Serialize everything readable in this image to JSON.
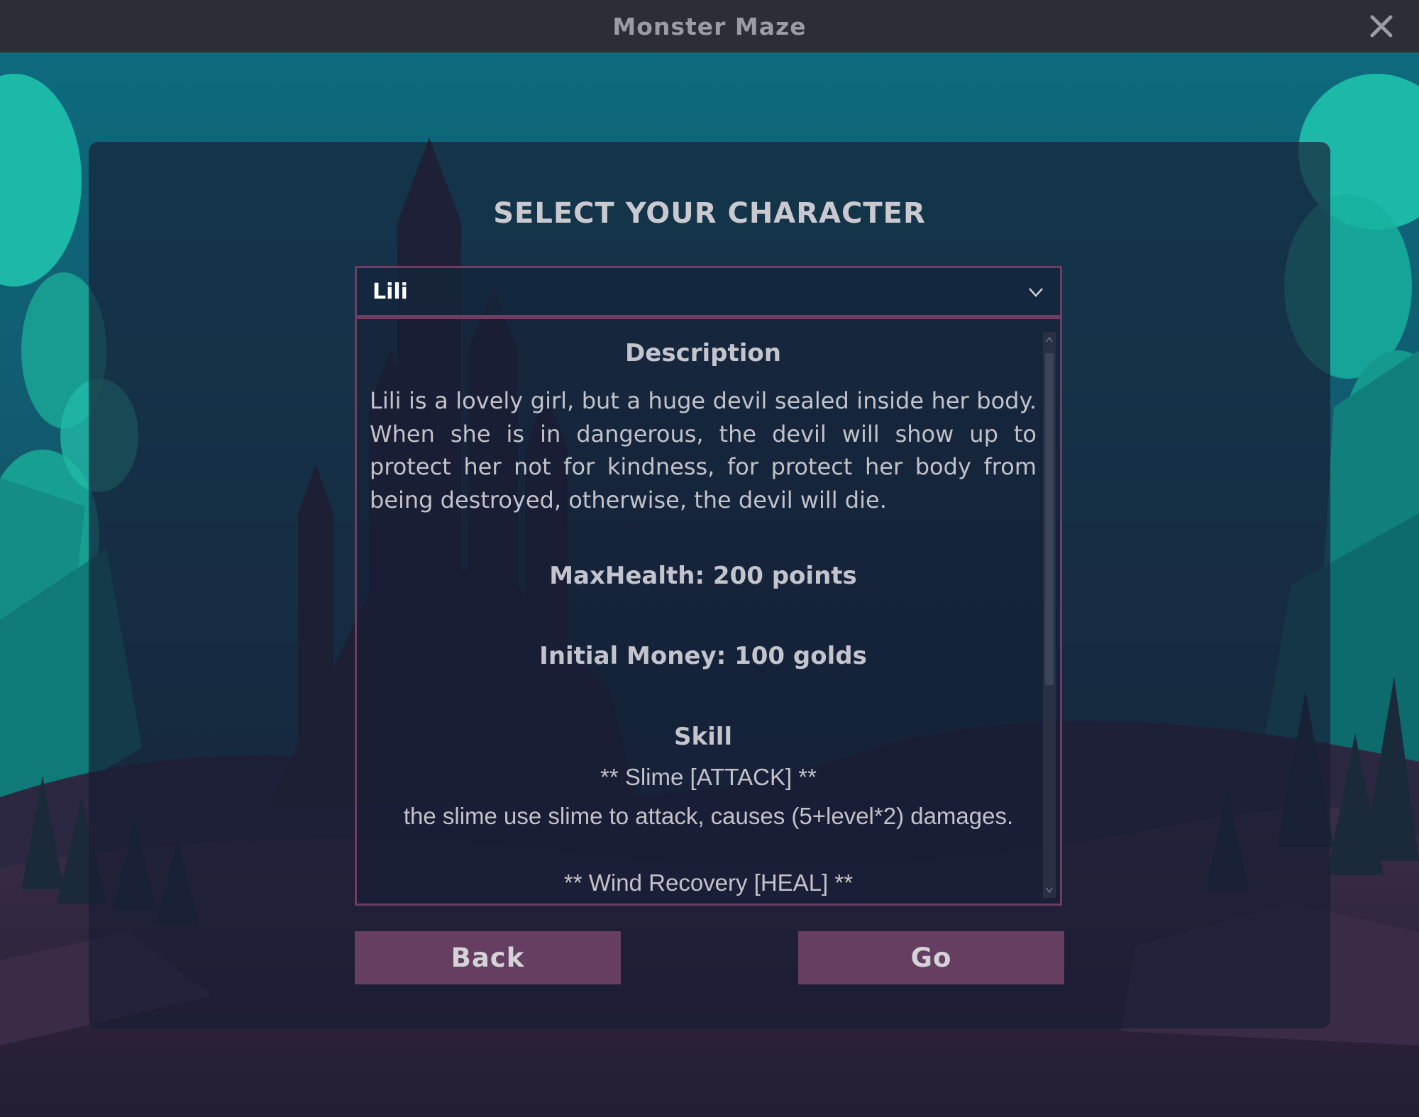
{
  "window": {
    "title": "Monster Maze",
    "close_icon": "close-icon"
  },
  "screen": {
    "heading": "SELECT YOUR CHARACTER"
  },
  "character_select": {
    "selected": "Lili",
    "dropdown_icon": "chevron-down-icon"
  },
  "info": {
    "description_heading": "Description",
    "description": "Lili is a lovely girl, but a huge devil sealed inside her body. When she is in dangerous, the devil will show up to protect her not for kindness, for protect her body from being destroyed, otherwise, the devil will die.",
    "max_health": "MaxHealth: 200 points",
    "initial_money": "Initial Money: 100 golds",
    "skill_heading": "Skill",
    "skills": [
      {
        "title": "** Slime [ATTACK] **",
        "desc": "the slime use slime to attack, causes (5+level*2) damages."
      },
      {
        "title": "** Wind Recovery [HEAL] **"
      }
    ]
  },
  "buttons": {
    "back": "Back",
    "go": "Go"
  },
  "colors": {
    "titlebar": "#2b2e35",
    "accent_border": "#6d3d62",
    "button": "#653e62",
    "sky_teal": "#0f6b7c",
    "foliage": "#19b8a6"
  }
}
